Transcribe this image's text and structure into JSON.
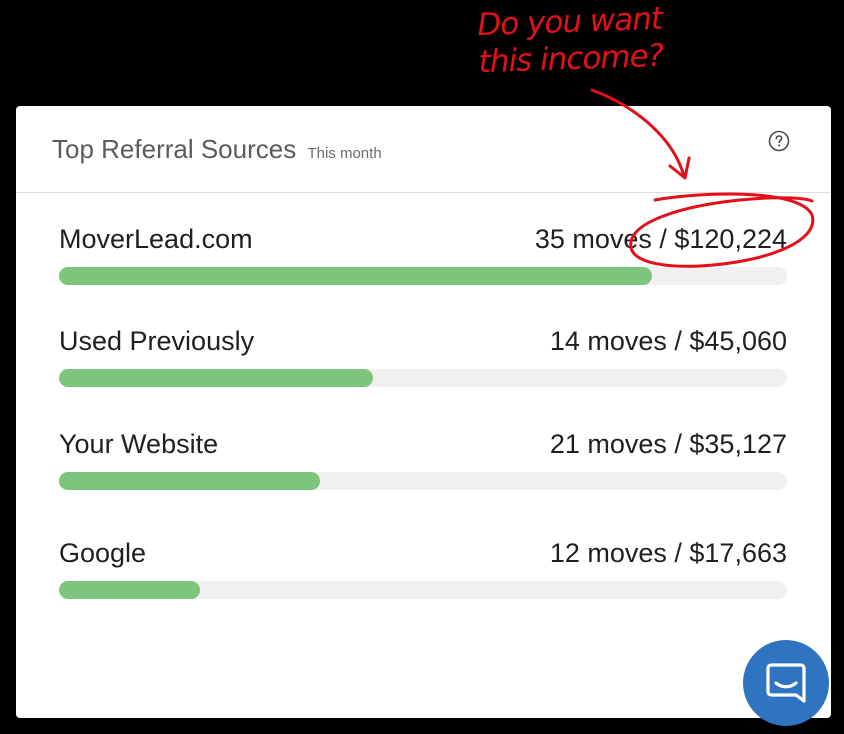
{
  "annotation": {
    "line1": "Do you want",
    "line2": "this income?",
    "color": "#e3101a"
  },
  "header": {
    "title": "Top Referral Sources",
    "subtitle": "This month",
    "help_icon": "question-circle-icon"
  },
  "rows": [
    {
      "name": "MoverLead.com",
      "stats": "35 moves / $120,224",
      "progress": 0.815
    },
    {
      "name": "Used Previously",
      "stats": "14 moves / $45,060",
      "progress": 0.432
    },
    {
      "name": "Your Website",
      "stats": "21 moves / $35,127",
      "progress": 0.359
    },
    {
      "name": "Google",
      "stats": "12 moves / $17,663",
      "progress": 0.193
    }
  ],
  "colors": {
    "bar_fill": "#7dc47d",
    "bar_track": "#f0f0f0",
    "chat_button": "#2f74c0"
  },
  "chat": {
    "icon": "chat-bubble-icon"
  }
}
